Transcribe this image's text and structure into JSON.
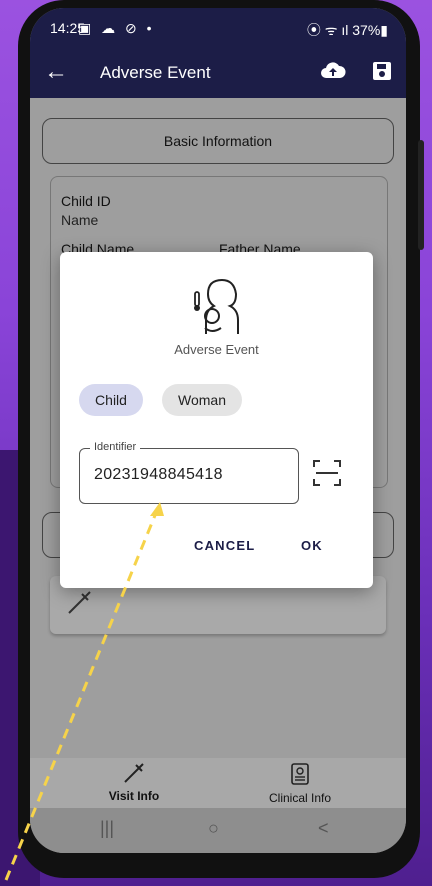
{
  "status_bar": {
    "time": "14:25",
    "left_icons": "▣ ☁ ⊘ •",
    "right_icons": "⦿ ᯤ ıl 37%▮"
  },
  "app_bar": {
    "title": "Adverse Event",
    "icons": [
      "back-arrow-icon",
      "cloud-upload-icon",
      "save-icon"
    ]
  },
  "form": {
    "basic_info_label": "Basic Information",
    "child_id_label": "Child ID",
    "child_id_value": "Name",
    "child_name_label": "Child Name",
    "father_name_label": "Father Name"
  },
  "dialog": {
    "title": "Adverse Event",
    "chips": {
      "child": "Child",
      "woman": "Woman"
    },
    "identifier_label": "Identifier",
    "identifier_value": "20231948845418",
    "cancel_label": "CANCEL",
    "ok_label": "OK"
  },
  "bottom_nav": {
    "visit_info": "Visit Info",
    "clinical_info": "Clinical Info"
  },
  "system_nav": {
    "recents": "|||",
    "home": "○",
    "back": "<"
  },
  "colors": {
    "appbar": "#1c1d47",
    "chip_selected": "#d6d8ef",
    "background": "#9b52e0"
  }
}
